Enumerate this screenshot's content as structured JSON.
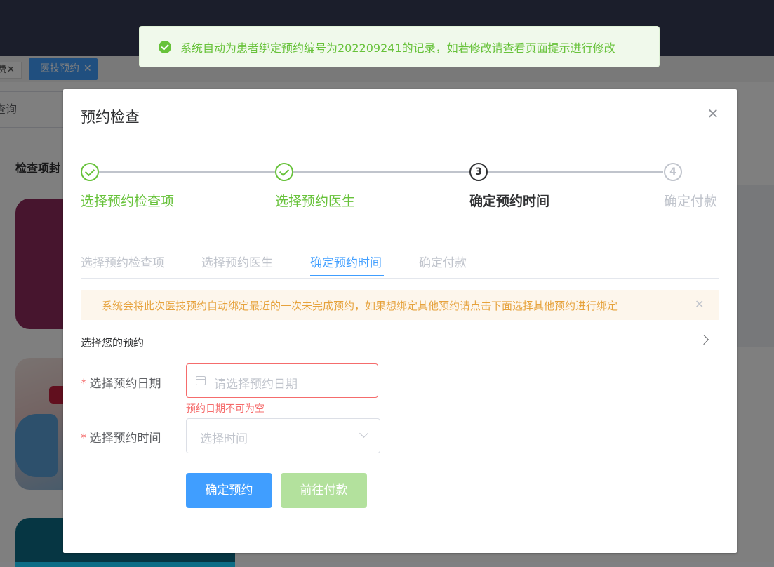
{
  "background": {
    "tabs": [
      {
        "label": "医技预约",
        "close": "✕",
        "active": true
      }
    ],
    "partial_tab": {
      "label": "费",
      "close": "✕"
    },
    "search_placeholder": "查询",
    "section_title": "检查项封"
  },
  "toast": {
    "type": "success",
    "icon": "check-circle-icon",
    "message": "系统自动为患者绑定预约编号为202209241的记录，如若修改请查看页面提示进行修改"
  },
  "dialog": {
    "title": "预约检查",
    "close_icon": "close-icon",
    "steps": [
      {
        "index": "1",
        "label": "选择预约检查项",
        "status": "done"
      },
      {
        "index": "2",
        "label": "选择预约医生",
        "status": "done"
      },
      {
        "index": "3",
        "label": "确定预约时间",
        "status": "process"
      },
      {
        "index": "4",
        "label": "确定付款",
        "status": "wait"
      }
    ],
    "tabs": [
      {
        "label": "选择预约检查项",
        "active": false
      },
      {
        "label": "选择预约医生",
        "active": false
      },
      {
        "label": "确定预约时间",
        "active": true
      },
      {
        "label": "确定付款",
        "active": false
      }
    ],
    "alert": {
      "type": "warning",
      "text": "系统会将此次医技预约自动绑定最近的一次未完成预约，如果想绑定其他预约请点击下面选择其他预约进行绑定",
      "close": "✕"
    },
    "select_booking": {
      "label": "选择您的预约"
    },
    "form": {
      "required_mark": "*",
      "date": {
        "label": "选择预约日期",
        "placeholder": "请选择预约日期",
        "value": "",
        "error": "预约日期不可为空"
      },
      "time": {
        "label": "选择预约时间",
        "placeholder": "选择时间",
        "value": ""
      }
    },
    "buttons": {
      "confirm": "确定预约",
      "pay": "前往付款"
    }
  },
  "colors": {
    "primary": "#409eff",
    "success": "#67c23a",
    "success_light": "#b3e19d",
    "warning": "#e6a23c",
    "danger": "#f56c6c",
    "header_bg": "#1b1e2b"
  }
}
